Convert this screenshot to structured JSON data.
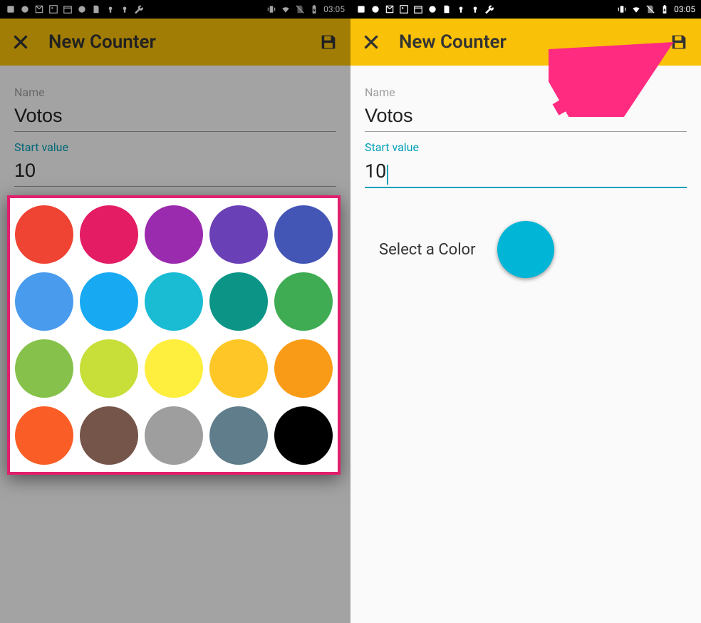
{
  "status": {
    "time": "03:05"
  },
  "appbar": {
    "title": "New Counter"
  },
  "form": {
    "name_label": "Name",
    "name_value": "Votos",
    "start_label": "Start value",
    "start_value": "10",
    "select_label": "Select a Color",
    "selected_color": "#00b5d6"
  },
  "picker": {
    "rows": [
      [
        "#ef4333",
        "#e31c63",
        "#9b2bae",
        "#6a40b6",
        "#4355b5"
      ],
      [
        "#499bed",
        "#17aaf3",
        "#1abcd4",
        "#0c9587",
        "#3fac54"
      ],
      [
        "#86c24b",
        "#c8de39",
        "#feee3d",
        "#fec727",
        "#fa9b18"
      ],
      [
        "#fa5e26",
        "#75554a",
        "#9e9e9e",
        "#5f7d8b",
        "#000000"
      ]
    ]
  }
}
